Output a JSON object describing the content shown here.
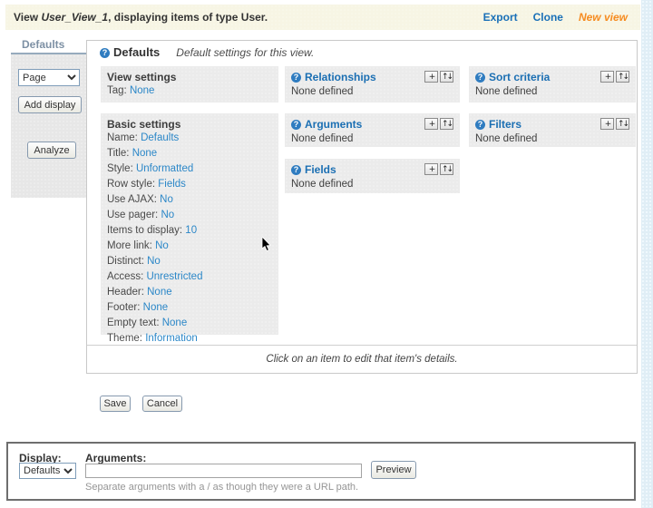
{
  "header": {
    "title_prefix": "View ",
    "view_name": "User_View_1",
    "title_suffix": ", displaying items of type User.",
    "links": {
      "export": "Export",
      "clone": "Clone",
      "new_view": "New view"
    }
  },
  "sidebar": {
    "tab_label": "Defaults",
    "display_type_value": "Page",
    "add_display_label": "Add display",
    "analyze_label": "Analyze"
  },
  "main": {
    "heading": "Defaults",
    "heading_note": "Default settings for this view.",
    "hint": "Click on an item to edit that item's details.",
    "save_label": "Save",
    "cancel_label": "Cancel",
    "boxes": {
      "view_settings": {
        "title": "View settings",
        "items": [
          {
            "label": "Tag:",
            "value": "None"
          }
        ]
      },
      "relationships": {
        "title": "Relationships",
        "empty": "None defined"
      },
      "sort_criteria": {
        "title": "Sort criteria",
        "empty": "None defined"
      },
      "basic_settings": {
        "title": "Basic settings",
        "items": [
          {
            "label": "Name:",
            "value": "Defaults"
          },
          {
            "label": "Title:",
            "value": "None"
          },
          {
            "label": "Style:",
            "value": "Unformatted"
          },
          {
            "label": "Row style:",
            "value": "Fields"
          },
          {
            "label": "Use AJAX:",
            "value": "No"
          },
          {
            "label": "Use pager:",
            "value": "No"
          },
          {
            "label": "Items to display:",
            "value": "10"
          },
          {
            "label": "More link:",
            "value": "No"
          },
          {
            "label": "Distinct:",
            "value": "No"
          },
          {
            "label": "Access:",
            "value": "Unrestricted"
          },
          {
            "label": "Header:",
            "value": "None"
          },
          {
            "label": "Footer:",
            "value": "None"
          },
          {
            "label": "Empty text:",
            "value": "None"
          },
          {
            "label": "Theme:",
            "value": "Information"
          }
        ]
      },
      "arguments": {
        "title": "Arguments",
        "empty": "None defined"
      },
      "filters": {
        "title": "Filters",
        "empty": "None defined"
      },
      "fields": {
        "title": "Fields",
        "empty": "None defined"
      }
    }
  },
  "preview_panel": {
    "display_label": "Display:",
    "display_value": "Defaults",
    "arguments_label": "Arguments:",
    "arguments_value": "",
    "preview_label": "Preview",
    "help_text": "Separate arguments with a / as though they were a URL path."
  },
  "icons": {
    "help": "?",
    "add": "+",
    "rearrange": "↑↓"
  },
  "colors": {
    "header_bg": "#f7f5e4",
    "box_bg": "#ebebeb",
    "link_blue": "#1b6fb3",
    "value_blue": "#2b87c8",
    "new_view_orange": "#f68b1f",
    "right_strip_blue": "#e0eef6"
  }
}
